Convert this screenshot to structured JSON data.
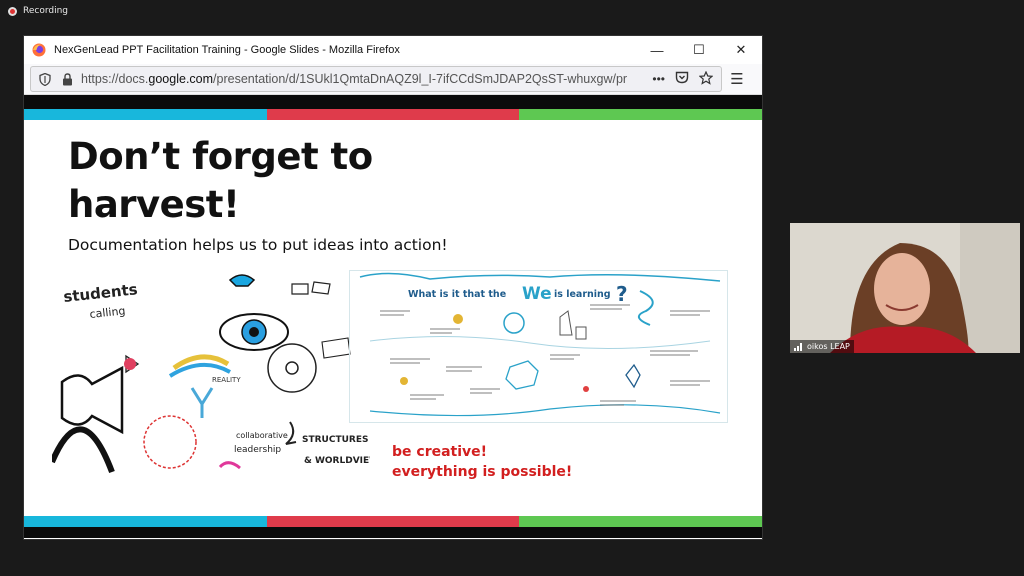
{
  "recording": {
    "label": "Recording"
  },
  "window": {
    "title": "NexGenLead PPT Facilitation Training - Google Slides - Mozilla Firefox",
    "minimize": "—",
    "maximize": "☐",
    "close": "✕"
  },
  "urlbar": {
    "prefix": "https://docs.",
    "domain": "google.com",
    "path": "/presentation/d/1SUkl1QmtaDnAQZ9l_I-7ifCCdSmJDAP2QsST-whuxgw/pr",
    "more": "•••",
    "menu": "☰"
  },
  "slide": {
    "headline_1": "Don’t forget to",
    "headline_2": "harvest!",
    "subtitle": "Documentation helps us to put ideas into action!",
    "sketch_left": {
      "students": "students",
      "calling": "calling",
      "structures": "STRUCTURES",
      "worldviews": "& WORLDVIEWS",
      "collaborative": "collaborative",
      "leadership": "leadership",
      "reality": "REALITY"
    },
    "sketch_right": {
      "question_prefix": "What is it that the",
      "we": "We",
      "question_suffix": "is learning",
      "qmark": "?"
    },
    "tagline_1": "be creative!",
    "tagline_2": "everything is possible!"
  },
  "camera": {
    "name": "oikos LEAP"
  },
  "colors": {
    "band_blue": "#18b7dc",
    "band_red": "#df3b4b",
    "band_green": "#5ec852",
    "tagline_red": "#d21f1f"
  }
}
